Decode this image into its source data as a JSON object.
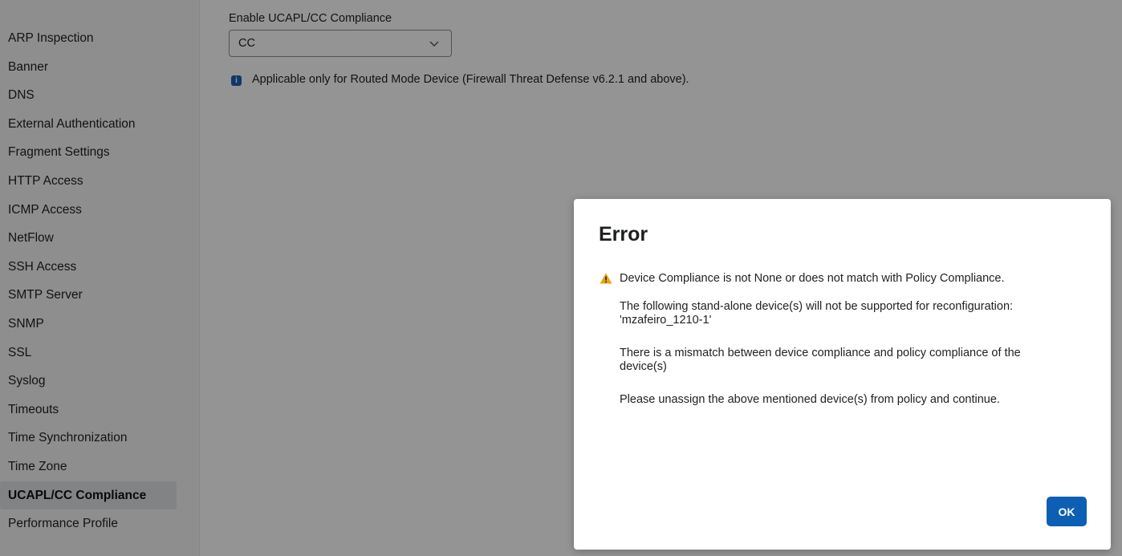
{
  "sidebar": {
    "items": [
      {
        "label": "ARP Inspection"
      },
      {
        "label": "Banner"
      },
      {
        "label": "DNS"
      },
      {
        "label": "External Authentication"
      },
      {
        "label": "Fragment Settings"
      },
      {
        "label": "HTTP Access"
      },
      {
        "label": "ICMP Access"
      },
      {
        "label": "NetFlow"
      },
      {
        "label": "SSH Access"
      },
      {
        "label": "SMTP Server"
      },
      {
        "label": "SNMP"
      },
      {
        "label": "SSL"
      },
      {
        "label": "Syslog"
      },
      {
        "label": "Timeouts"
      },
      {
        "label": "Time Synchronization"
      },
      {
        "label": "Time Zone"
      },
      {
        "label": "UCAPL/CC Compliance",
        "active": true
      },
      {
        "label": "Performance Profile"
      }
    ]
  },
  "main": {
    "field_label": "Enable UCAPL/CC Compliance",
    "select_value": "CC",
    "info_text": "Applicable only for Routed Mode Device (Firewall Threat Defense v6.2.1 and above).",
    "info_icon": "info-icon"
  },
  "dialog": {
    "title": "Error",
    "warning_icon": "warning-triangle-icon",
    "warning_color": "#e8a317",
    "warning_text": "Device Compliance is not None or does not match with Policy Compliance.",
    "paragraph1_line1": "The following stand-alone device(s) will not be supported for reconfiguration:",
    "paragraph1_line2": "'mzafeiro_1210-1'",
    "paragraph2_line1": "There is a mismatch between device compliance and policy compliance of the",
    "paragraph2_line2": "device(s)",
    "paragraph3": "Please unassign the above mentioned device(s) from policy and continue.",
    "ok_label": "OK",
    "ok_color": "#0d5fb4"
  }
}
